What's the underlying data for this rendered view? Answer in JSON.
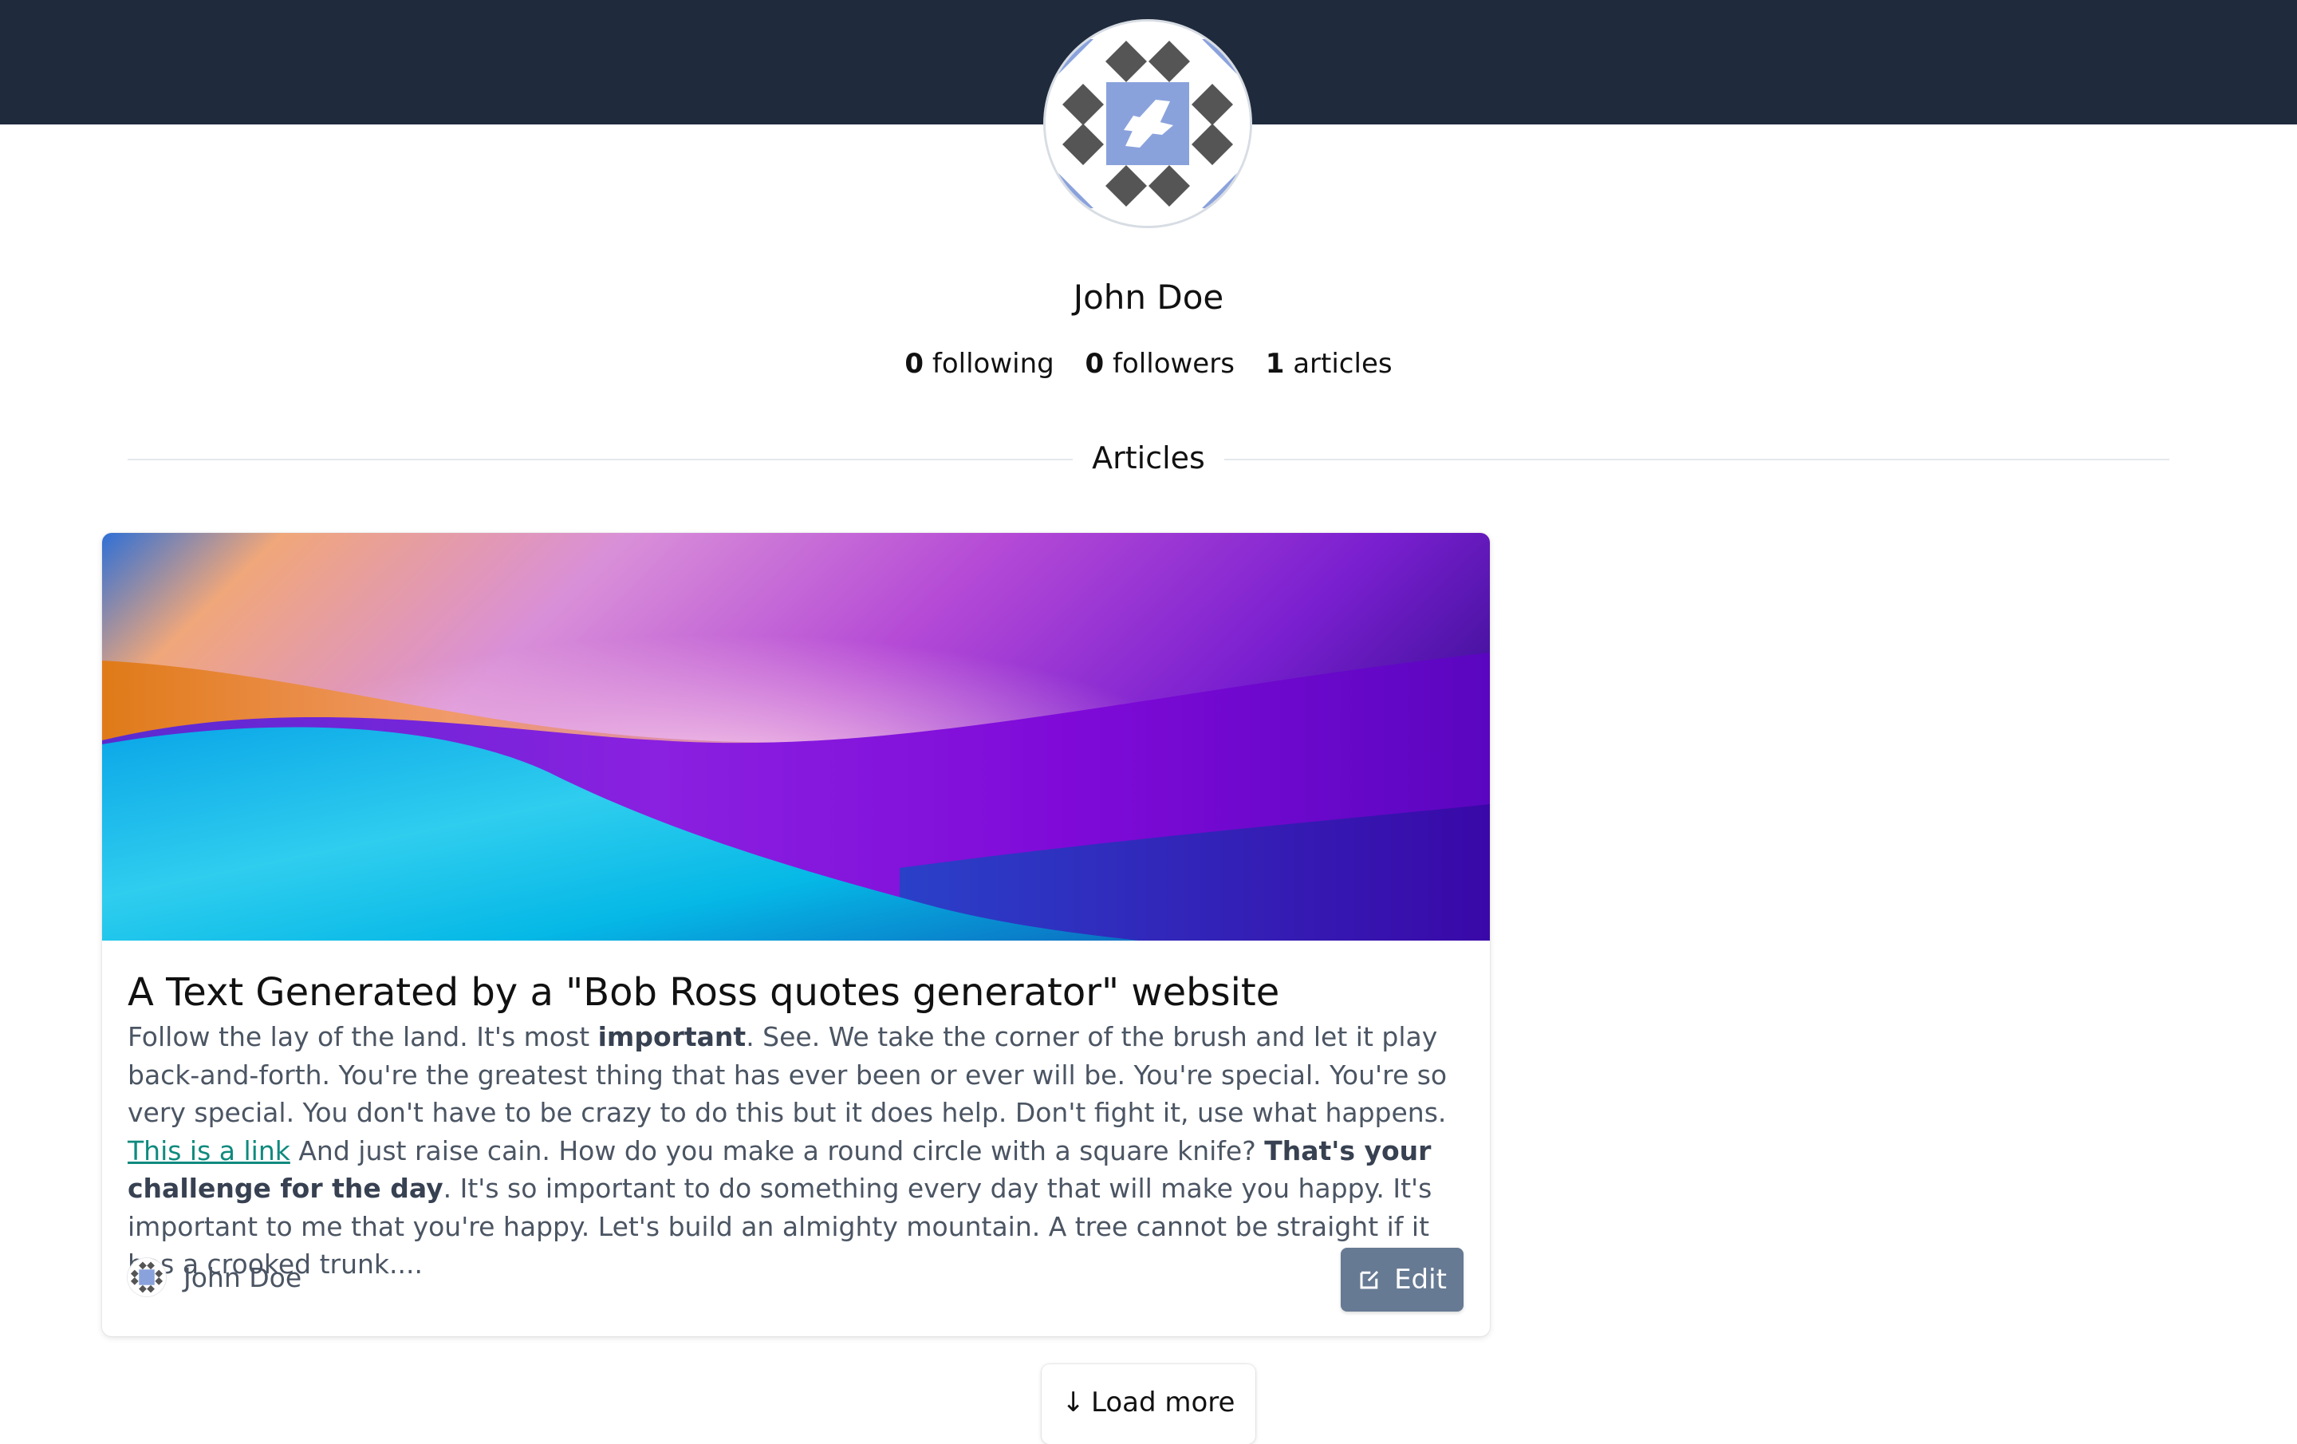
{
  "profile": {
    "name": "John Doe",
    "stats": {
      "following_count": "0",
      "following_label": "following",
      "followers_count": "0",
      "followers_label": "followers",
      "articles_count": "1",
      "articles_label": "articles"
    }
  },
  "section": {
    "title": "Articles"
  },
  "article": {
    "title": "A Text Generated by a \"Bob Ross quotes generator\" website",
    "excerpt": {
      "p1": "Follow the lay of the land. It's most ",
      "b1": "important",
      "p2": ". See. We take the corner of the brush and let it play back-and-forth. You're the greatest thing that has ever been or ever will be. You're special. You're so very special. You don't have to be crazy to do this but it does help. Don't fight it, use what happens. ",
      "link": "This is a link",
      "p3": " And just raise cain. How do you make a round circle with a square knife? ",
      "b2": "That's your challenge for the day",
      "p4": ". It's so important to do something every day that will make you happy. It's important to me that you're happy. Let's build an almighty mountain. A tree cannot be straight if it has a crooked trunk...."
    },
    "author": "John Doe",
    "edit_label": "Edit"
  },
  "load_more": {
    "arrow": "↓",
    "label": "Load more"
  },
  "colors": {
    "topbar": "#1f2a3c",
    "avatar_accent": "#8aa2dc",
    "avatar_diamond": "#555555",
    "edit_button": "#677a93",
    "link": "#0f8a7e"
  },
  "icons": {
    "avatar": "identicon-avatar",
    "edit": "edit-icon",
    "load_more": "arrow-down-icon"
  }
}
